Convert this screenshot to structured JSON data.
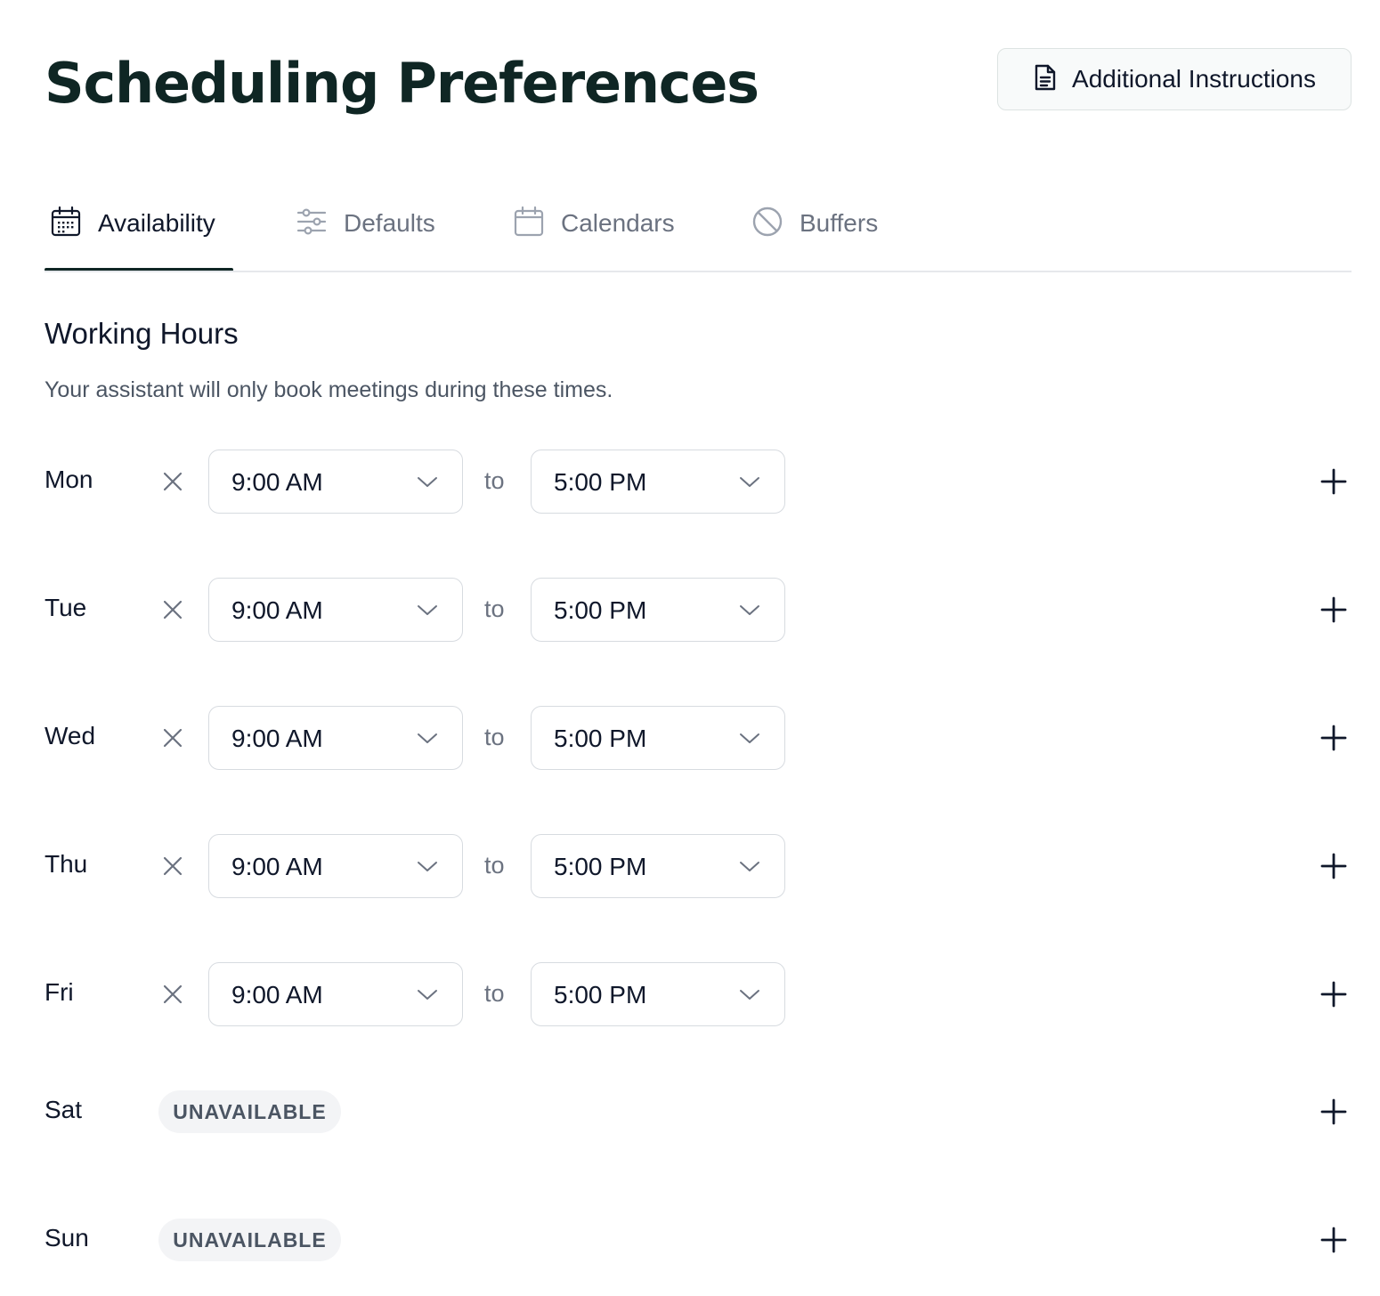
{
  "header": {
    "title": "Scheduling Preferences",
    "instructions_button": "Additional Instructions"
  },
  "tabs": [
    {
      "label": "Availability",
      "icon": "calendar-grid-icon",
      "active": true
    },
    {
      "label": "Defaults",
      "icon": "sliders-icon",
      "active": false
    },
    {
      "label": "Calendars",
      "icon": "calendar-icon",
      "active": false
    },
    {
      "label": "Buffers",
      "icon": "ban-icon",
      "active": false
    }
  ],
  "working_hours": {
    "title": "Working Hours",
    "description": "Your assistant will only book meetings during these times.",
    "separator": "to",
    "unavailable_label": "UNAVAILABLE",
    "days": [
      {
        "day": "Mon",
        "start": "9:00 AM",
        "end": "5:00 PM",
        "available": true
      },
      {
        "day": "Tue",
        "start": "9:00 AM",
        "end": "5:00 PM",
        "available": true
      },
      {
        "day": "Wed",
        "start": "9:00 AM",
        "end": "5:00 PM",
        "available": true
      },
      {
        "day": "Thu",
        "start": "9:00 AM",
        "end": "5:00 PM",
        "available": true
      },
      {
        "day": "Fri",
        "start": "9:00 AM",
        "end": "5:00 PM",
        "available": true
      },
      {
        "day": "Sat",
        "available": false
      },
      {
        "day": "Sun",
        "available": false
      }
    ]
  },
  "colors": {
    "title": "#0f2624",
    "text": "#0f172a",
    "muted": "#6b7280",
    "border": "#d7dbe0",
    "badge_bg": "#f3f4f6"
  }
}
